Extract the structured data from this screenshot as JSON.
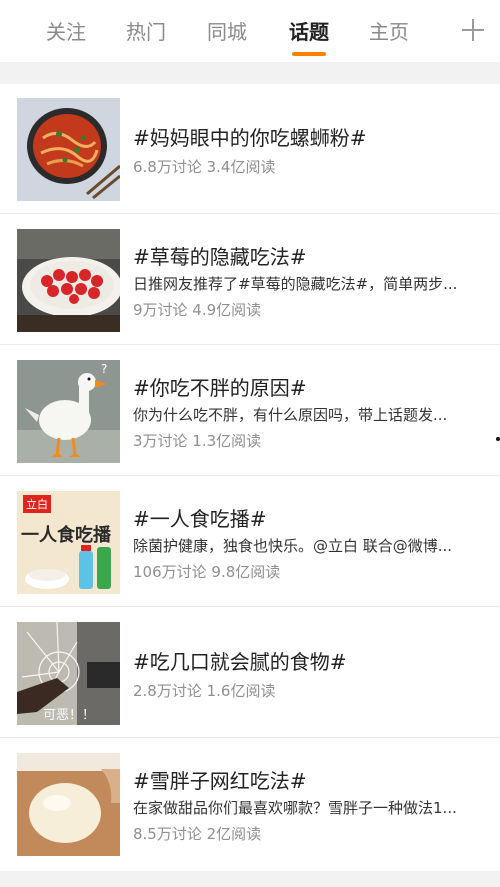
{
  "tabs": [
    "关注",
    "热门",
    "同城",
    "话题",
    "主页"
  ],
  "active_tab": "话题",
  "add_icon": "plus-icon",
  "colors": {
    "accent": "#ff8200",
    "title": "#222222",
    "stats": "#8f8f8f"
  },
  "topics": [
    {
      "title": "#妈妈眼中的你吃螺蛳粉#",
      "desc": "",
      "stats": "6.8万讨论 3.4亿阅读",
      "thumb": "noodle-bowl-image"
    },
    {
      "title": "#草莓的隐藏吃法#",
      "desc": "日推网友推荐了#草莓的隐藏吃法#，简单两步...",
      "stats": "9万讨论 4.9亿阅读",
      "thumb": "strawberry-plate-image"
    },
    {
      "title": "#你吃不胖的原因#",
      "desc": "你为什么吃不胖，有什么原因吗，带上话题发...",
      "stats": "3万讨论 1.3亿阅读",
      "thumb": "goose-image"
    },
    {
      "title": "#一人食吃播#",
      "desc": "除菌护健康，独食也快乐。@立白 联合@微博...",
      "stats": "106万讨论 9.8亿阅读",
      "thumb": "libai-ad-image",
      "thumb_text": "一人食吃播",
      "thumb_logo": "立白"
    },
    {
      "title": "#吃几口就会腻的食物#",
      "desc": "",
      "stats": "2.8万讨论 1.6亿阅读",
      "thumb": "cracked-glass-image",
      "thumb_caption": "可恶！！"
    },
    {
      "title": "#雪胖子网红吃法#",
      "desc": "在家做甜品你们最喜欢哪款？雪胖子一种做法1...",
      "stats": "8.5万讨论 2亿阅读",
      "thumb": "snow-cake-image"
    }
  ]
}
